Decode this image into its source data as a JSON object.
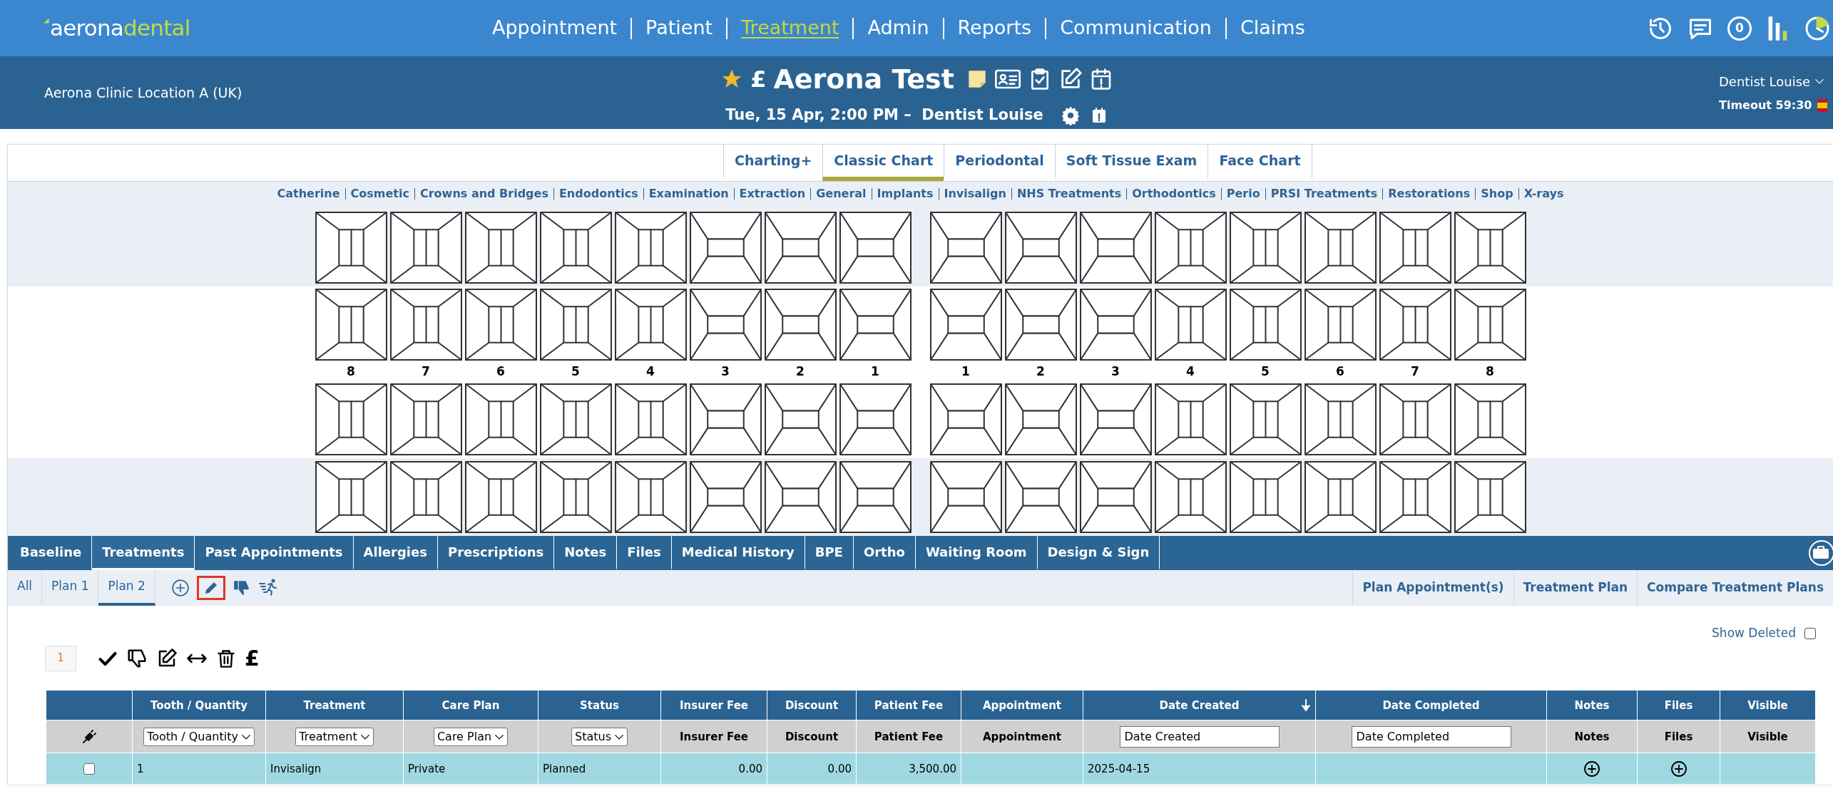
{
  "header": {
    "logo": {
      "part1": "aerona",
      "part2": "dental"
    },
    "nav": [
      {
        "label": "Appointment",
        "selected": false
      },
      {
        "label": "Patient",
        "selected": false
      },
      {
        "label": "Treatment",
        "selected": true
      },
      {
        "label": "Admin",
        "selected": false
      },
      {
        "label": "Reports",
        "selected": false
      },
      {
        "label": "Communication",
        "selected": false
      },
      {
        "label": "Claims",
        "selected": false
      }
    ],
    "notification_count": "0"
  },
  "patient_bar": {
    "clinic": "Aerona Clinic Location A (UK)",
    "currency": "£",
    "patient_name": "Aerona Test",
    "appointment": "Tue, 15 Apr, 2:00 PM –  Dentist Louise",
    "user": "Dentist Louise",
    "timeout": "Timeout 59:30"
  },
  "chart_tabs": [
    {
      "label": "Charting+",
      "selected": false
    },
    {
      "label": "Classic Chart",
      "selected": true
    },
    {
      "label": "Periodontal",
      "selected": false
    },
    {
      "label": "Soft Tissue Exam",
      "selected": false
    },
    {
      "label": "Face Chart",
      "selected": false
    }
  ],
  "categories": [
    "Catherine",
    "Cosmetic",
    "Crowns and Bridges",
    "Endodontics",
    "Examination",
    "Extraction",
    "General",
    "Implants",
    "Invisalign",
    "NHS Treatments",
    "Orthodontics",
    "Perio",
    "PRSI Treatments",
    "Restorations",
    "Shop",
    "X-rays"
  ],
  "tooth_chart": {
    "rows": [
      [
        {
          "kind": "posterior"
        },
        {
          "kind": "posterior"
        },
        {
          "kind": "posterior"
        },
        {
          "kind": "posterior"
        },
        {
          "kind": "posterior"
        },
        {
          "kind": "anterior"
        },
        {
          "kind": "anterior"
        },
        {
          "kind": "anterior"
        },
        {
          "kind": "anterior"
        },
        {
          "kind": "anterior"
        },
        {
          "kind": "anterior"
        },
        {
          "kind": "posterior"
        },
        {
          "kind": "posterior"
        },
        {
          "kind": "posterior"
        },
        {
          "kind": "posterior"
        },
        {
          "kind": "posterior"
        }
      ],
      [
        {
          "kind": "posterior"
        },
        {
          "kind": "posterior"
        },
        {
          "kind": "posterior"
        },
        {
          "kind": "posterior"
        },
        {
          "kind": "posterior"
        },
        {
          "kind": "anterior"
        },
        {
          "kind": "anterior"
        },
        {
          "kind": "anterior"
        },
        {
          "kind": "anterior"
        },
        {
          "kind": "anterior"
        },
        {
          "kind": "anterior"
        },
        {
          "kind": "posterior"
        },
        {
          "kind": "posterior"
        },
        {
          "kind": "posterior"
        },
        {
          "kind": "posterior"
        },
        {
          "kind": "posterior"
        }
      ],
      [
        {
          "kind": "posterior"
        },
        {
          "kind": "posterior"
        },
        {
          "kind": "posterior"
        },
        {
          "kind": "posterior"
        },
        {
          "kind": "posterior"
        },
        {
          "kind": "anterior"
        },
        {
          "kind": "anterior"
        },
        {
          "kind": "anterior"
        },
        {
          "kind": "anterior"
        },
        {
          "kind": "anterior"
        },
        {
          "kind": "anterior"
        },
        {
          "kind": "posterior"
        },
        {
          "kind": "posterior"
        },
        {
          "kind": "posterior"
        },
        {
          "kind": "posterior"
        },
        {
          "kind": "posterior"
        }
      ],
      [
        {
          "kind": "posterior"
        },
        {
          "kind": "posterior"
        },
        {
          "kind": "posterior"
        },
        {
          "kind": "posterior"
        },
        {
          "kind": "posterior"
        },
        {
          "kind": "anterior"
        },
        {
          "kind": "anterior"
        },
        {
          "kind": "anterior"
        },
        {
          "kind": "anterior"
        },
        {
          "kind": "anterior"
        },
        {
          "kind": "anterior"
        },
        {
          "kind": "posterior"
        },
        {
          "kind": "posterior"
        },
        {
          "kind": "posterior"
        },
        {
          "kind": "posterior"
        },
        {
          "kind": "posterior"
        }
      ]
    ],
    "numbers": [
      "8",
      "7",
      "6",
      "5",
      "4",
      "3",
      "2",
      "1",
      "1",
      "2",
      "3",
      "4",
      "5",
      "6",
      "7",
      "8"
    ]
  },
  "record_tabs": [
    {
      "label": "Baseline",
      "selected": false
    },
    {
      "label": "Treatments",
      "selected": true
    },
    {
      "label": "Past Appointments",
      "selected": false
    },
    {
      "label": "Allergies",
      "selected": false
    },
    {
      "label": "Prescriptions",
      "selected": false
    },
    {
      "label": "Notes",
      "selected": false
    },
    {
      "label": "Files",
      "selected": false
    },
    {
      "label": "Medical History",
      "selected": false
    },
    {
      "label": "BPE",
      "selected": false
    },
    {
      "label": "Ortho",
      "selected": false
    },
    {
      "label": "Waiting Room",
      "selected": false
    },
    {
      "label": "Design & Sign",
      "selected": false
    }
  ],
  "plan_tabs": [
    {
      "label": "All",
      "selected": false
    },
    {
      "label": "Plan 1",
      "selected": false
    },
    {
      "label": "Plan 2",
      "selected": true
    }
  ],
  "plan_links": [
    "Plan Appointment(s)",
    "Treatment Plan",
    "Compare Treatment Plans"
  ],
  "show_deleted": {
    "label": "Show Deleted",
    "checked": false
  },
  "item_count": "1",
  "action_currency": "£",
  "table": {
    "columns": [
      {},
      {
        "label": "Tooth / Quantity"
      },
      {
        "label": "Treatment"
      },
      {
        "label": "Care Plan"
      },
      {
        "label": "Status"
      },
      {
        "label": "Insurer Fee"
      },
      {
        "label": "Discount"
      },
      {
        "label": "Patient Fee"
      },
      {
        "label": "Appointment"
      },
      {
        "label": "Date Created",
        "sorted": true
      },
      {
        "label": "Date Completed"
      },
      {
        "label": "Notes"
      },
      {
        "label": "Files"
      },
      {
        "label": "Visible"
      }
    ],
    "filters": [
      {
        "kind": "icon"
      },
      {
        "kind": "select",
        "text": "Tooth / Quantity"
      },
      {
        "kind": "select",
        "text": "Treatment"
      },
      {
        "kind": "select",
        "text": "Care Plan"
      },
      {
        "kind": "select",
        "text": "Status"
      },
      {
        "kind": "label",
        "text": "Insurer Fee"
      },
      {
        "kind": "label",
        "text": "Discount"
      },
      {
        "kind": "label",
        "text": "Patient Fee"
      },
      {
        "kind": "label",
        "text": "Appointment"
      },
      {
        "kind": "input",
        "value": "Date Created"
      },
      {
        "kind": "input",
        "value": "Date Completed"
      },
      {
        "kind": "label",
        "text": "Notes"
      },
      {
        "kind": "label",
        "text": "Files"
      },
      {
        "kind": "label",
        "text": "Visible"
      }
    ],
    "rows": [
      {
        "cells": [
          {
            "kind": "checkbox",
            "checked": false
          },
          {
            "kind": "text",
            "text": "1"
          },
          {
            "kind": "text",
            "text": "Invisalign"
          },
          {
            "kind": "text",
            "text": "Private"
          },
          {
            "kind": "text",
            "text": "Planned"
          },
          {
            "kind": "number",
            "text": "0.00"
          },
          {
            "kind": "number",
            "text": "0.00"
          },
          {
            "kind": "number",
            "text": "3,500.00"
          },
          {
            "kind": "empty"
          },
          {
            "kind": "text",
            "text": "2025-04-15"
          },
          {
            "kind": "empty"
          },
          {
            "kind": "add"
          },
          {
            "kind": "add"
          },
          {
            "kind": "empty"
          }
        ]
      }
    ]
  }
}
